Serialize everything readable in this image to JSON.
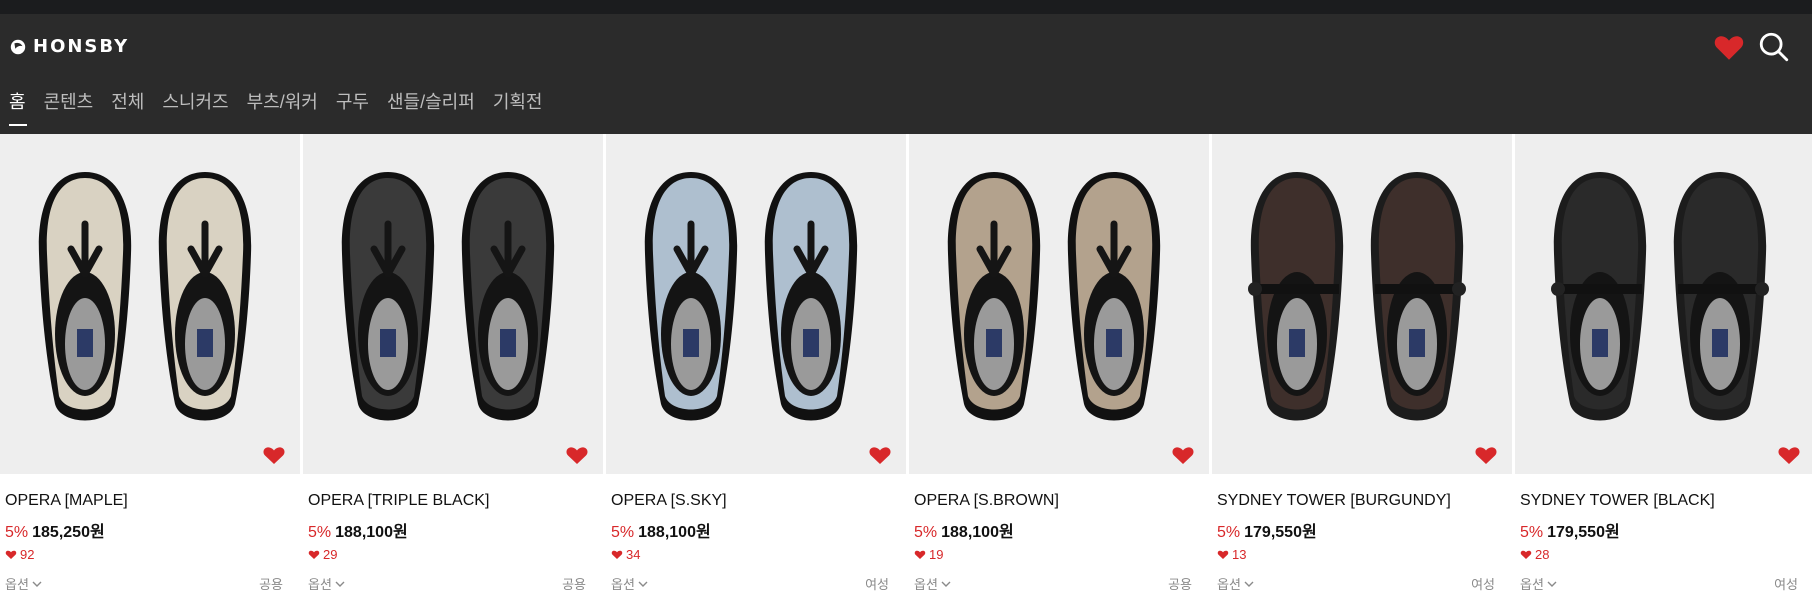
{
  "brand": {
    "name": "HONSBY"
  },
  "header": {
    "wishlist_icon": "heart-icon",
    "search_icon": "search-icon"
  },
  "nav": [
    {
      "label": "홈",
      "active": true
    },
    {
      "label": "콘텐츠"
    },
    {
      "label": "전체"
    },
    {
      "label": "스니커즈"
    },
    {
      "label": "부츠/워커"
    },
    {
      "label": "구두"
    },
    {
      "label": "샌들/슬리퍼"
    },
    {
      "label": "기획전"
    }
  ],
  "colors": {
    "accent": "#d8282a",
    "header_bg": "#2b2b2b"
  },
  "products": [
    {
      "name": "OPERA [MAPLE]",
      "discount": "5%",
      "price": "185,250원",
      "likes": "92",
      "option_label": "옵션",
      "gender": "공용",
      "upper": "#d9d2c2",
      "style": "opera"
    },
    {
      "name": "OPERA [TRIPLE BLACK]",
      "discount": "5%",
      "price": "188,100원",
      "likes": "29",
      "option_label": "옵션",
      "gender": "공용",
      "upper": "#3a3a3a",
      "style": "opera"
    },
    {
      "name": "OPERA [S.SKY]",
      "discount": "5%",
      "price": "188,100원",
      "likes": "34",
      "option_label": "옵션",
      "gender": "여성",
      "upper": "#aebfcf",
      "style": "opera"
    },
    {
      "name": "OPERA [S.BROWN]",
      "discount": "5%",
      "price": "188,100원",
      "likes": "19",
      "option_label": "옵션",
      "gender": "공용",
      "upper": "#b3a28d",
      "style": "opera"
    },
    {
      "name": "SYDNEY TOWER [BURGUNDY]",
      "discount": "5%",
      "price": "179,550원",
      "likes": "13",
      "option_label": "옵션",
      "gender": "여성",
      "upper": "#3e2f2b",
      "style": "sydney"
    },
    {
      "name": "SYDNEY TOWER [BLACK]",
      "discount": "5%",
      "price": "179,550원",
      "likes": "28",
      "option_label": "옵션",
      "gender": "여성",
      "upper": "#2a2a2a",
      "style": "sydney"
    }
  ]
}
